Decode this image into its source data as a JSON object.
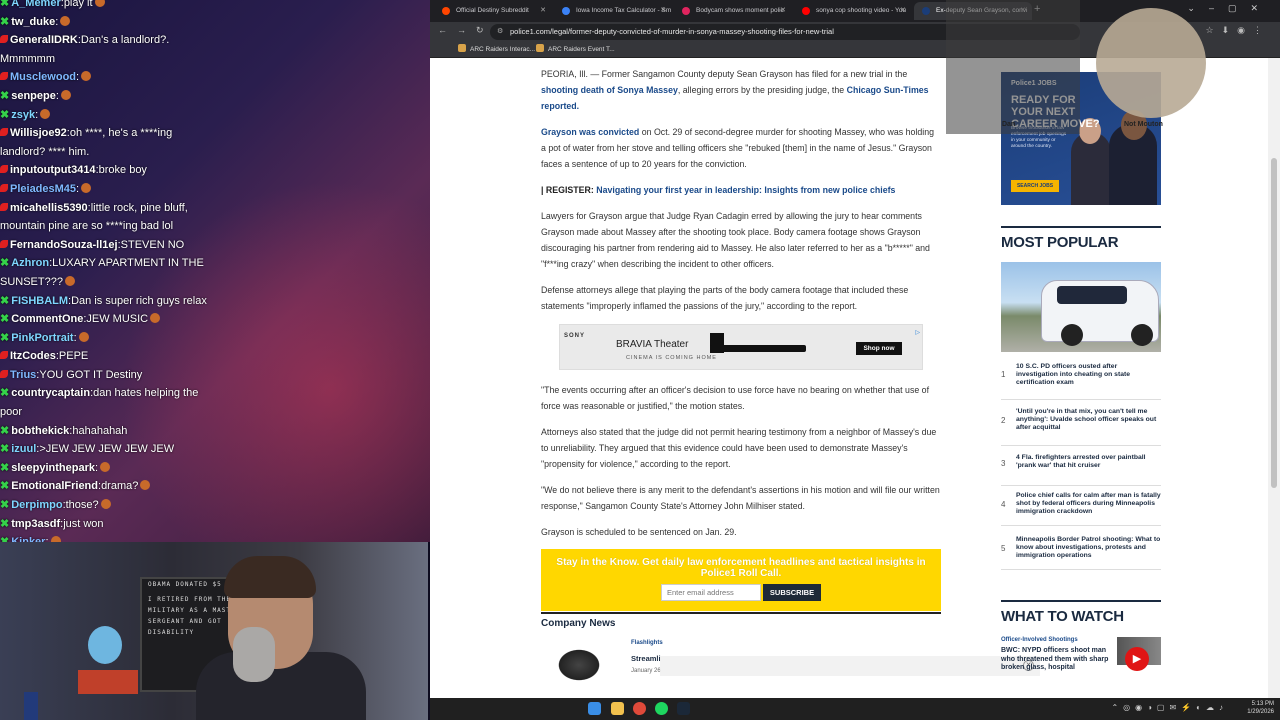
{
  "chat": {
    "messages": [
      {
        "badge": "green",
        "user": "A_Memer",
        "text": "play it",
        "color": "#7fd6ff",
        "emote": true
      },
      {
        "badge": "green",
        "user": "tw_duke",
        "text": "",
        "color": "#ffffff",
        "emote": true
      },
      {
        "badge": "red",
        "user": "GeneralIDRK",
        "text": "Dan's a landlord?. Mmmmmm",
        "color": "#ffffff",
        "emote": false
      },
      {
        "badge": "red",
        "user": "Musclewood",
        "text": "",
        "color": "#7fb8ff",
        "emote": true
      },
      {
        "badge": "green",
        "user": "senpepe",
        "text": "",
        "color": "#ffffff",
        "emote": true
      },
      {
        "badge": "green",
        "user": "zsyk",
        "text": "",
        "color": "#7fd6ff",
        "emote": true
      },
      {
        "badge": "red",
        "user": "Willisjoe92",
        "text": "oh ****, he's a ****ing landlord? **** him.",
        "color": "#ffffff",
        "emote": false
      },
      {
        "badge": "red",
        "user": "inputoutput3414",
        "text": "broke boy",
        "color": "#ffffff",
        "emote": false
      },
      {
        "badge": "red",
        "user": "PleiadesM45",
        "text": "",
        "color": "#7fb8ff",
        "emote": true
      },
      {
        "badge": "red",
        "user": "micahellis5390",
        "text": "little rock, pine bluff, mountain pine are so ****ing bad lol",
        "color": "#ffffff",
        "emote": false
      },
      {
        "badge": "red",
        "user": "FernandoSouza-ll1ej",
        "text": "STEVEN NO",
        "color": "#ffffff",
        "emote": false
      },
      {
        "badge": "green",
        "user": "Azhron",
        "text": "LUXARY APARTMENT IN THE SUNSET???",
        "color": "#7fd6ff",
        "emote": true
      },
      {
        "badge": "green",
        "user": "FISHBALM",
        "text": "Dan is super rich guys relax",
        "color": "#7fd6ff",
        "emote": false
      },
      {
        "badge": "green",
        "user": "CommentOne",
        "text": "JEW MUSIC",
        "color": "#ffffff",
        "emote": true
      },
      {
        "badge": "green",
        "user": "PinkPortrait",
        "text": "",
        "color": "#7fd6ff",
        "emote": true
      },
      {
        "badge": "red",
        "user": "ItzCodes",
        "text": "PEPE",
        "color": "#ffffff",
        "emote": false
      },
      {
        "badge": "red",
        "user": "Trius",
        "text": "YOU GOT IT  Destiny",
        "color": "#7fb8ff",
        "emote": false
      },
      {
        "badge": "green",
        "user": "countrycaptain",
        "text": "dan hates helping the poor",
        "color": "#ffffff",
        "emote": false
      },
      {
        "badge": "green",
        "user": "bobthekick",
        "text": "hahahahah",
        "color": "#ffffff",
        "emote": false
      },
      {
        "badge": "green",
        "user": "izuul",
        "text": ">JEW JEW JEW JEW JEW",
        "color": "#7fd6ff",
        "emote": false
      },
      {
        "badge": "green",
        "user": "sleepyinthepark",
        "text": "",
        "color": "#ffffff",
        "emote": true
      },
      {
        "badge": "green",
        "user": "EmotionalFriend",
        "text": "drama?",
        "color": "#ffffff",
        "emote": true
      },
      {
        "badge": "green",
        "user": "Derpimpo",
        "text": "those?",
        "color": "#7fd6ff",
        "emote": true
      },
      {
        "badge": "green",
        "user": "tmp3asdf",
        "text": "just won",
        "color": "#ffffff",
        "emote": false
      },
      {
        "badge": "green",
        "user": "Kinker",
        "text": "",
        "color": "#7fb8ff",
        "emote": true
      }
    ]
  },
  "webcam": {
    "board_lines": [
      "OBAMA DONATED $5",
      "",
      "I RETIRED FROM THE",
      "MILITARY AS A MASTER",
      "SERGEANT AND GOT",
      "DISABILITY"
    ]
  },
  "browser": {
    "tabs": [
      {
        "label": "Official Destiny Subreddit",
        "fav": "#ff4500",
        "active": false
      },
      {
        "label": "Iowa Income Tax Calculator - Sm",
        "fav": "#3b82f6",
        "active": false
      },
      {
        "label": "Bodycam shows moment polic",
        "fav": "#e0245e",
        "active": false
      },
      {
        "label": "sonya cop shooting video - You",
        "fav": "#ff0000",
        "active": false
      },
      {
        "label": "Ex-deputy Sean Grayson, convi",
        "fav": "#1b3d78",
        "active": true
      }
    ],
    "url": "police1.com/legal/former-deputy-convicted-of-murder-in-sonya-massey-shooting-files-for-new-trial",
    "bookmarks": [
      "ARC Raiders Interac...",
      "ARC Raiders Event T..."
    ]
  },
  "article": {
    "p1": {
      "pre": "PEORIA, Ill. — Former Sangamon County deputy Sean Grayson has filed for a new trial in the ",
      "link1": "shooting death of Sonya Massey",
      "mid": ", alleging errors by the presiding judge, the ",
      "link2": "Chicago Sun-Times reported."
    },
    "p2": {
      "link": "Grayson was convicted",
      "text": " on Oct. 29 of second-degree murder for shooting Massey, who was holding a pot of water from her stove and telling officers she \"rebuked [them] in the name of Jesus.\" Grayson faces a sentence of up to 20 years for the conviction."
    },
    "p3": {
      "label": "| REGISTER: ",
      "link": "Navigating your first year in leadership: Insights from new police chiefs"
    },
    "p4": "Lawyers for Grayson argue that Judge Ryan Cadagin erred by allowing the jury to hear comments Grayson made about Massey after the shooting took place. Body camera footage shows Grayson discouraging his partner from rendering aid to Massey. He also later referred to her as a \"b*****\" and \"f***ing crazy\" when describing the incident to other officers.",
    "p5": "Defense attorneys allege that playing the parts of the body camera footage that included these statements \"improperly inflamed the passions of the jury,\" according to the report.",
    "ad": {
      "brand": "SONY",
      "product": "BRAVIA Theater",
      "tagline": "CINEMA IS COMING HOME",
      "cta": "Shop now"
    },
    "p6": "\"The events occurring after an officer's decision to use force have no bearing on whether that use of force was reasonable or justified,\" the motion states.",
    "p7": "Attorneys also stated that the judge did not permit hearing testimony from a neighbor of Massey's due to unreliability. They argued that this evidence could have been used to demonstrate Massey's \"propensity for violence,\" according to the report.",
    "p8": "\"We do not believe there is any merit to the defendant's assertions in his motion and will file our written response,\" Sangamon County State's Attorney John Milhiser stated.",
    "p9": "Grayson is scheduled to be sentenced on Jan. 29.",
    "newsletter": {
      "title": "Stay in the Know. Get daily law enforcement headlines and tactical insights in Police1 Roll Call.",
      "placeholder": "Enter email address",
      "button": "SUBSCRIBE"
    },
    "company": {
      "heading": "Company News",
      "category": "Flashlights",
      "title": "Streamli",
      "date": "January 26"
    }
  },
  "sidebar": {
    "ad": {
      "logo": "Police1 JOBS",
      "headline": "READY FOR YOUR NEXT CAREER MOVE?",
      "body": "Browse thousands of law enforcement job openings in your community or around the country.",
      "button": "SEARCH JOBS"
    },
    "most_popular_title": "MOST POPULAR",
    "most_popular": [
      {
        "n": "1",
        "title": "10 S.C. PD officers ousted after investigation into cheating on state certification exam"
      },
      {
        "n": "2",
        "title": "'Until you're in that mix, you can't tell me anything': Uvalde school officer speaks out after acquittal"
      },
      {
        "n": "3",
        "title": "4 Fla. firefighters arrested over paintball 'prank war' that hit cruiser"
      },
      {
        "n": "4",
        "title": "Police chief calls for calm after man is fatally shot by federal officers during Minneapolis immigration crackdown"
      },
      {
        "n": "5",
        "title": "Minneapolis Border Patrol shooting: What to know about investigations, protests and immigration operations"
      }
    ],
    "what_to_watch_title": "WHAT TO WATCH",
    "watch": {
      "category": "Officer-Involved Shootings",
      "title": "BWC: NYPD officers shoot man who threatened them with sharp broken glass, hospital"
    }
  },
  "overlay": {
    "left_label": "Dan",
    "right_label": "Not Mouton"
  },
  "taskbar": {
    "time": "5:13 PM",
    "date": "1/29/2026"
  }
}
